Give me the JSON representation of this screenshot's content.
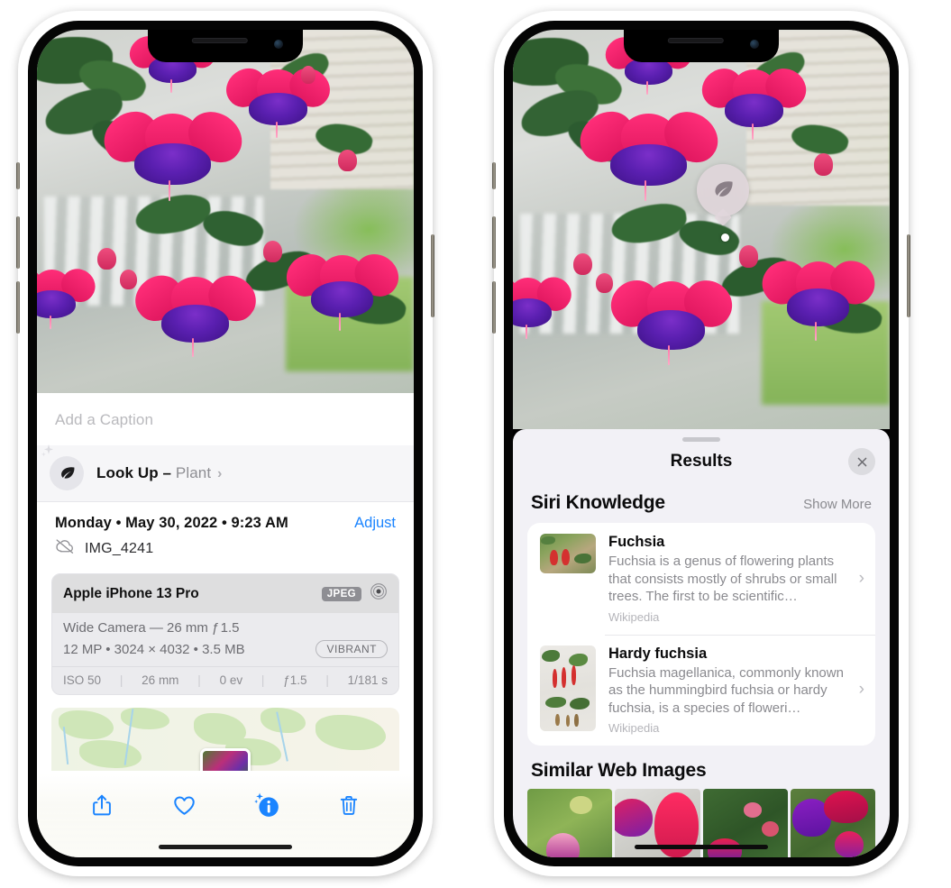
{
  "left_phone": {
    "caption_placeholder": "Add a Caption",
    "lookup": {
      "label": "Look Up",
      "dash": " – ",
      "kind": "Plant",
      "chevron": "›",
      "icon": "leaf-icon"
    },
    "meta": {
      "date_line": "Monday • May 30, 2022 • 9:23 AM",
      "adjust_label": "Adjust",
      "filename": "IMG_4241",
      "cloud_icon": "cloud-slash-icon"
    },
    "camera_card": {
      "model": "Apple iPhone 13 Pro",
      "format_badge": "JPEG",
      "aperture_icon": "aperture-icon",
      "lens": "Wide Camera — 26 mm ƒ 1.5",
      "specs": "12 MP • 3024 × 4032 • 3.5 MB",
      "style_badge": "VIBRANT",
      "exif": [
        "ISO 50",
        "26 mm",
        "0 ev",
        "ƒ1.5",
        "1/181 s"
      ],
      "exif_separator": "|"
    },
    "toolbar": [
      {
        "name": "share-button",
        "icon": "share-icon"
      },
      {
        "name": "favorite-button",
        "icon": "heart-icon"
      },
      {
        "name": "info-button",
        "icon": "info-sparkle-icon"
      },
      {
        "name": "delete-button",
        "icon": "trash-icon"
      }
    ],
    "accent_color": "#1a84ff"
  },
  "right_phone": {
    "visual_lookup_badge": {
      "icon": "leaf-icon",
      "name": "visual-lookup-badge"
    },
    "sheet": {
      "title": "Results",
      "close_icon": "close-icon",
      "sections": [
        {
          "title": "Siri Knowledge",
          "action_label": "Show More",
          "items": [
            {
              "title": "Fuchsia",
              "description": "Fuchsia is a genus of flowering plants that consists mostly of shrubs or small trees. The first to be scientific…",
              "source": "Wikipedia",
              "chevron": "›"
            },
            {
              "title": "Hardy fuchsia",
              "description": "Fuchsia magellanica, commonly known as the hummingbird fuchsia or hardy fuchsia, is a species of floweri…",
              "source": "Wikipedia",
              "chevron": "›"
            }
          ]
        },
        {
          "title": "Similar Web Images",
          "tiles": 4
        }
      ]
    }
  },
  "colors": {
    "accent": "#1a84ff",
    "sheet_bg": "#f2f1f6",
    "card_bg": "#ffffff",
    "secondary_text": "#8a8a8f",
    "page_bg": "#ffffff"
  }
}
